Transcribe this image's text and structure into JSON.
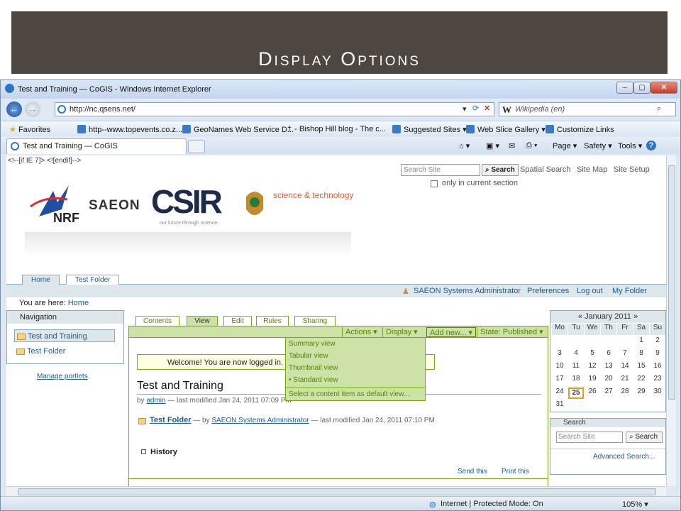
{
  "slide": {
    "title": "Display Options"
  },
  "window": {
    "title": "Test and Training — CoGIS - Windows Internet Explorer",
    "min": "–",
    "max": "▢",
    "close": "✕"
  },
  "address": {
    "url": "http://nc.qsens.net/",
    "search_placeholder": "Wikipedia (en)",
    "search_w": "W"
  },
  "favorites": {
    "label": "Favorites",
    "items": [
      "http--www.topevents.co.z...",
      "GeoNames Web Service D...",
      "- Bishop Hill blog - The c...",
      "Suggested Sites ▾",
      "Web Slice Gallery ▾",
      "Customize Links"
    ]
  },
  "tabs": {
    "active": "Test and Training — CoGIS"
  },
  "commands": {
    "page": "Page ▾",
    "safety": "Safety ▾",
    "tools": "Tools ▾",
    "help": "?"
  },
  "page": {
    "conditional_comment": "<!--[if IE 7]> <![endif]-->",
    "search_placeholder": "Search Site",
    "search_button": "Search",
    "top_links": [
      "Spatial Search",
      "Site Map",
      "Site Setup"
    ],
    "only_current": "only in current section",
    "logos": {
      "nrf": "NRF",
      "saeon": "SAEON",
      "csir": "CSIR",
      "csir_tagline": "our future through science",
      "dst": "science & technology"
    },
    "portal_tabs": [
      "Home",
      "Test Folder"
    ],
    "personal": {
      "user": "SAEON Systems Administrator",
      "preferences": "Preferences",
      "logout": "Log out",
      "my_folder": "My Folder"
    },
    "breadcrumb": {
      "prefix": "You are here:",
      "home": "Home"
    },
    "navigation": {
      "title": "Navigation",
      "items": [
        "Test and Training",
        "Test Folder"
      ]
    },
    "manage_portlets": "Manage portlets",
    "content_tabs": [
      "Contents",
      "View",
      "Edit",
      "Rules",
      "Sharing"
    ],
    "content_bar": {
      "actions": "Actions ▾",
      "display": "Display ▾",
      "add_new": "Add new... ▾",
      "state": "State: Published ▾"
    },
    "display_menu": [
      "Summary view",
      "Tabular view",
      "Thumbnail view",
      "• Standard view",
      "Select a content item as default view..."
    ],
    "welcome": "Welcome! You are now logged in.",
    "doc_title": "Test and Training",
    "byline": {
      "by": "by",
      "author": "admin",
      "modified": "— last modified Jan 24, 2011 07:09 PM"
    },
    "folder_entry": {
      "name": "Test Folder",
      "by": "— by",
      "author": "SAEON Systems Administrator",
      "modified": "— last modified Jan 24, 2011 07:10 PM"
    },
    "history": "History",
    "doc_actions": [
      "Send this",
      "Print this"
    ],
    "calendar": {
      "title": "« January 2011 »",
      "days": [
        "Mo",
        "Tu",
        "We",
        "Th",
        "Fr",
        "Sa",
        "Su"
      ],
      "weeks": [
        [
          "",
          "",
          "",
          "",
          "",
          "1",
          "2"
        ],
        [
          "3",
          "4",
          "5",
          "6",
          "7",
          "8",
          "9"
        ],
        [
          "10",
          "11",
          "12",
          "13",
          "14",
          "15",
          "16"
        ],
        [
          "17",
          "18",
          "19",
          "20",
          "21",
          "22",
          "23"
        ],
        [
          "24",
          "25",
          "26",
          "27",
          "28",
          "29",
          "30"
        ],
        [
          "31",
          "",
          "",
          "",
          "",
          "",
          ""
        ]
      ],
      "today": "25"
    },
    "search_portlet": {
      "title": "Search",
      "placeholder": "Search Site",
      "button": "Search",
      "advanced": "Advanced Search..."
    }
  },
  "status": {
    "zone": "Internet | Protected Mode: On",
    "zoom": "105% ▾"
  }
}
